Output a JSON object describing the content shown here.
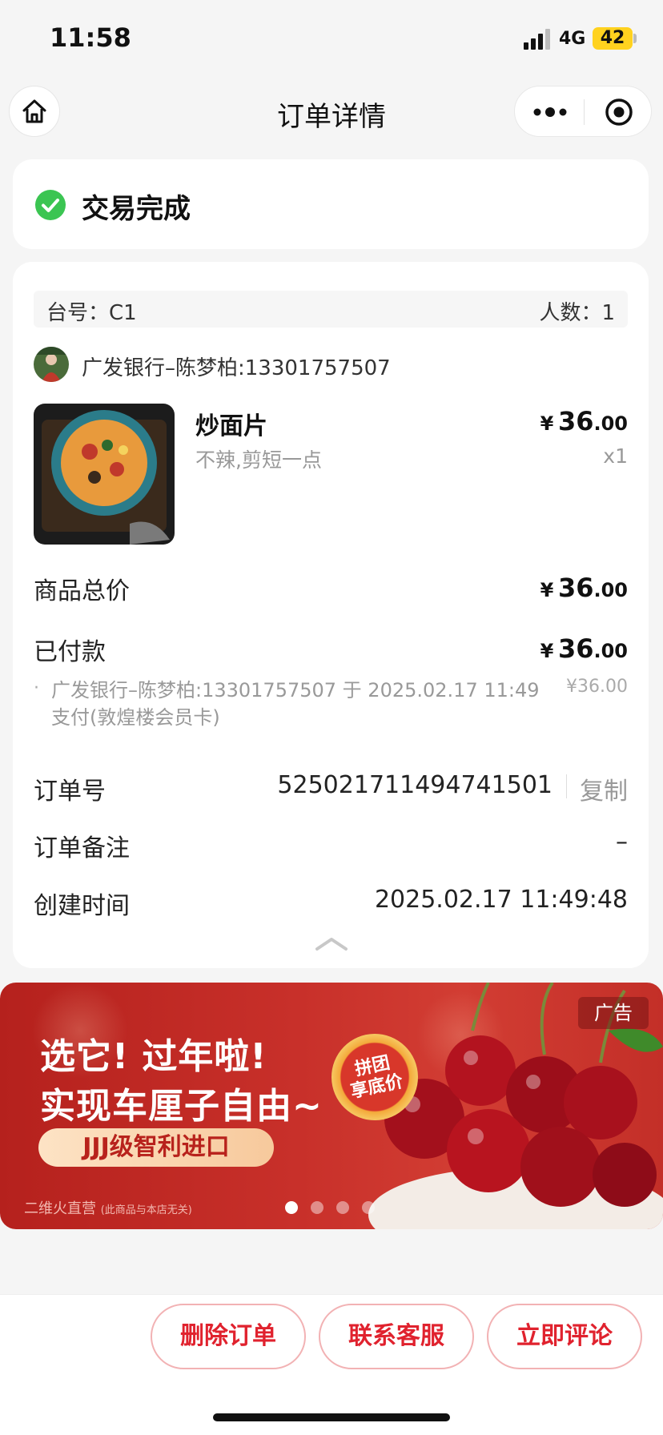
{
  "status_bar": {
    "time": "11:58",
    "network": "4G",
    "battery": "42"
  },
  "nav": {
    "title": "订单详情",
    "home_icon": "home-icon",
    "more_icon": "more-icon",
    "close_icon": "target-icon"
  },
  "order_status": {
    "text": "交易完成",
    "color": "#3bc552"
  },
  "table_info": {
    "table": "台号：C1",
    "guests": "人数：1"
  },
  "member": {
    "name": "广发银行–陈梦柏:13301757507"
  },
  "item": {
    "name": "炒面片",
    "note": "不辣,剪短一点",
    "price_symbol": "¥",
    "price_int": "36",
    "price_dec": ".00",
    "qty": "x1"
  },
  "summary": {
    "total_label": "商品总价",
    "total_symbol": "¥",
    "total_int": "36",
    "total_dec": ".00",
    "paid_label": "已付款",
    "paid_symbol": "¥",
    "paid_int": "36",
    "paid_dec": ".00",
    "payment_bullet": "·",
    "payment_desc": "广发银行–陈梦柏:13301757507 于 2025.02.17 11:49 支付(敦煌楼会员卡)",
    "payment_amount": "¥36.00"
  },
  "order": {
    "number_label": "订单号",
    "number": "525021711494741501",
    "copy_label": "复制",
    "remark_label": "订单备注",
    "remark": "–",
    "created_label": "创建时间",
    "created": "2025.02.17 11:49:48"
  },
  "ad": {
    "line1": "选它! 过年啦!",
    "line2": "实现车厘子自由~",
    "pill": "JJJ级智利进口",
    "badge_line1": "拼团",
    "badge_line2": "享底价",
    "tag": "广告",
    "source": "二维火直营",
    "source_note": "(此商品与本店无关)",
    "carousel_count": 4,
    "carousel_active": 1
  },
  "actions": {
    "delete": "删除订单",
    "contact": "联系客服",
    "review": "立即评论",
    "accent_color": "#e0222e"
  }
}
